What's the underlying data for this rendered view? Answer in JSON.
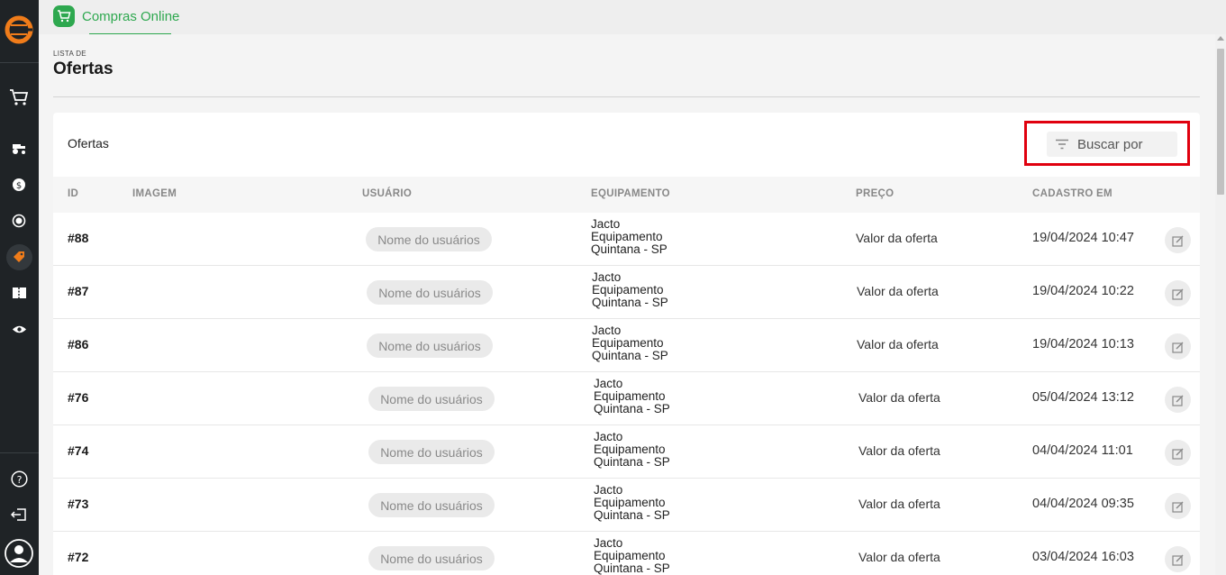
{
  "app": {
    "name": "Compras Online"
  },
  "page": {
    "kicker": "LISTA DE",
    "title": "Ofertas"
  },
  "card": {
    "title": "Ofertas",
    "search_label": "Buscar por"
  },
  "table": {
    "headers": {
      "id": "ID",
      "image": "IMAGEM",
      "user": "USUÁRIO",
      "equipment": "EQUIPAMENTO",
      "price": "PREÇO",
      "created": "CADASTRO EM"
    },
    "rows": [
      {
        "id": "#88",
        "user": "Nome do usuários",
        "equipment": [
          "Jacto",
          "Equipamento",
          "Quintana - SP"
        ],
        "price": "Valor da oferta",
        "created": "19/04/2024 10:47"
      },
      {
        "id": "#87",
        "user": "Nome do usuários",
        "equipment": [
          "Jacto",
          "Equipamento",
          "Quintana - SP"
        ],
        "price": "Valor da oferta",
        "created": "19/04/2024 10:22"
      },
      {
        "id": "#86",
        "user": "Nome do usuários",
        "equipment": [
          "Jacto",
          "Equipamento",
          "Quintana - SP"
        ],
        "price": "Valor da oferta",
        "created": "19/04/2024 10:13"
      },
      {
        "id": "#76",
        "user": "Nome do usuários",
        "equipment": [
          "Jacto",
          "Equipamento",
          "Quintana - SP"
        ],
        "price": "Valor da oferta",
        "created": "05/04/2024 13:12"
      },
      {
        "id": "#74",
        "user": "Nome do usuários",
        "equipment": [
          "Jacto",
          "Equipamento",
          "Quintana - SP"
        ],
        "price": "Valor da oferta",
        "created": "04/04/2024 11:01"
      },
      {
        "id": "#73",
        "user": "Nome do usuários",
        "equipment": [
          "Jacto",
          "Equipamento",
          "Quintana - SP"
        ],
        "price": "Valor da oferta",
        "created": "04/04/2024 09:35"
      },
      {
        "id": "#72",
        "user": "Nome do usuários",
        "equipment": [
          "Jacto",
          "Equipamento",
          "Quintana - SP"
        ],
        "price": "Valor da oferta",
        "created": "03/04/2024 16:03"
      }
    ]
  },
  "sidebar": {
    "icons": [
      "logo-icon",
      "cart-icon",
      "tractor-icon",
      "dollar-icon",
      "exchange-icon",
      "tag-icon",
      "ticket-icon",
      "eye-icon",
      "help-icon",
      "logout-icon",
      "user-avatar-icon"
    ],
    "active": "tag-icon"
  },
  "colors": {
    "accent": "#2ea84f",
    "sidebar": "#1f2326",
    "logo": "#f07c1a",
    "highlight": "#e0000e"
  }
}
